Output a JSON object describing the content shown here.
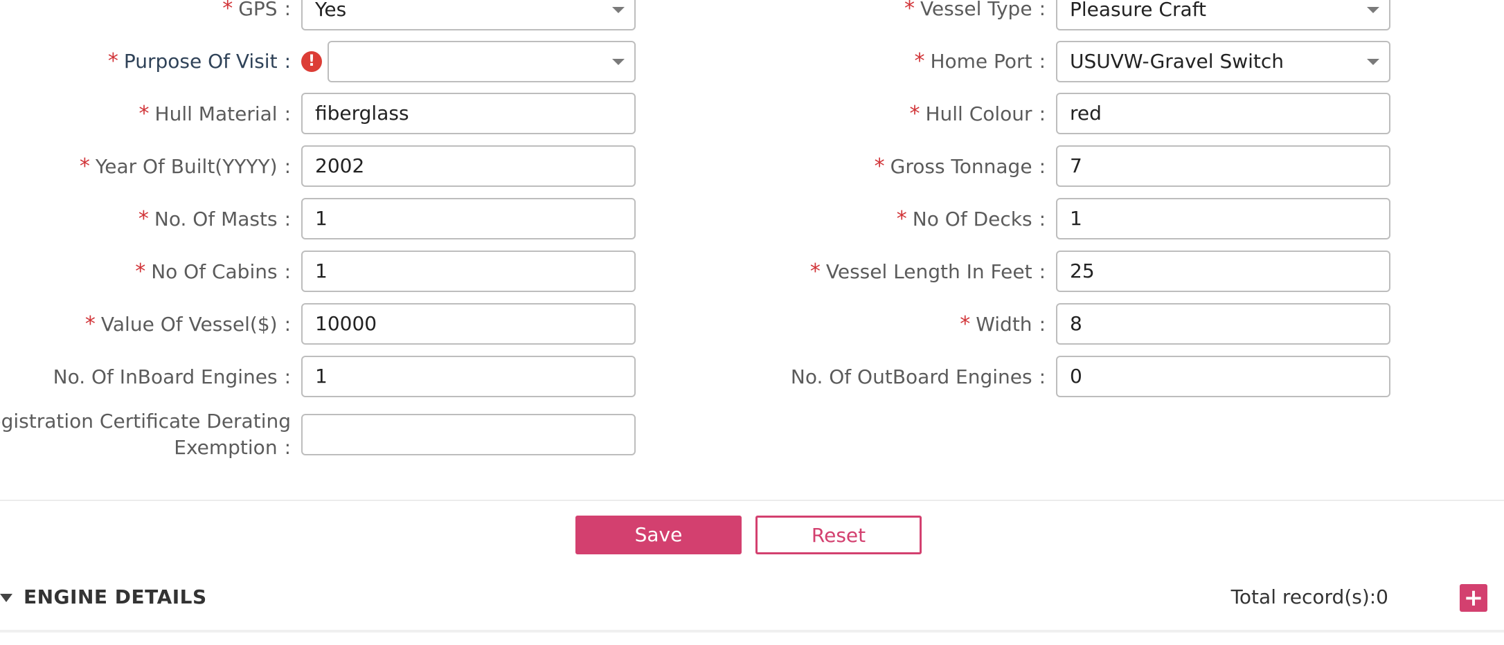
{
  "form": {
    "left": [
      {
        "label": "GPS",
        "required": true,
        "type": "select",
        "value": "Yes"
      },
      {
        "label": "Purpose Of Visit",
        "required": true,
        "type": "select",
        "value": "",
        "error": true
      },
      {
        "label": "Hull Material",
        "required": true,
        "type": "text",
        "value": "fiberglass"
      },
      {
        "label": "Year Of Built(YYYY)",
        "required": true,
        "type": "text",
        "value": "2002"
      },
      {
        "label": "No. Of Masts",
        "required": true,
        "type": "text",
        "value": "1"
      },
      {
        "label": "No Of Cabins",
        "required": true,
        "type": "text",
        "value": "1"
      },
      {
        "label": "Value Of Vessel($)",
        "required": true,
        "type": "text",
        "value": "10000"
      },
      {
        "label": "No. Of InBoard Engines",
        "required": false,
        "type": "text",
        "value": "1"
      },
      {
        "label_line1": "Registration Certificate Derating",
        "label_line2": "Exemption",
        "required": false,
        "type": "text",
        "value": ""
      }
    ],
    "right": [
      {
        "label": "Vessel Type",
        "required": true,
        "type": "select",
        "value": "Pleasure Craft"
      },
      {
        "label": "Home Port",
        "required": true,
        "type": "select",
        "value": "USUVW-Gravel Switch"
      },
      {
        "label": "Hull Colour",
        "required": true,
        "type": "text",
        "value": "red"
      },
      {
        "label": "Gross Tonnage",
        "required": true,
        "type": "text",
        "value": "7"
      },
      {
        "label": "No Of Decks",
        "required": true,
        "type": "text",
        "value": "1"
      },
      {
        "label": "Vessel Length In Feet",
        "required": true,
        "type": "text",
        "value": "25"
      },
      {
        "label": "Width",
        "required": true,
        "type": "text",
        "value": "8"
      },
      {
        "label": "No. Of OutBoard Engines",
        "required": false,
        "type": "text",
        "value": "0"
      }
    ],
    "required_mark": "*",
    "colon": ":",
    "error_glyph": "!"
  },
  "actions": {
    "save_label": "Save",
    "reset_label": "Reset"
  },
  "engine_section": {
    "title": "ENGINE DETAILS",
    "total_records": "Total record(s):0",
    "add_glyph": "+"
  },
  "colors": {
    "accent": "#d3406f",
    "required": "#d13438",
    "error": "#dc3d36"
  }
}
